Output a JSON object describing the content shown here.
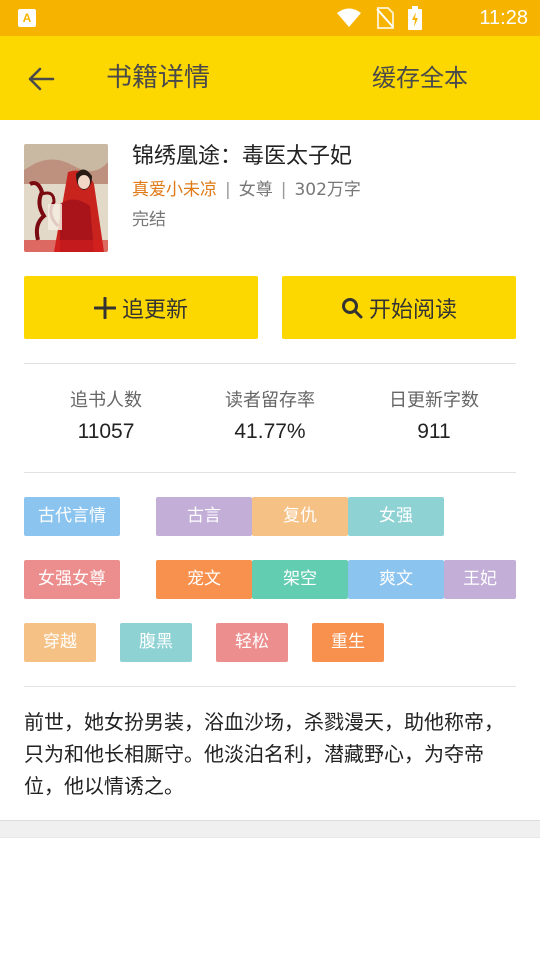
{
  "status_bar": {
    "time": "11:28",
    "icons": [
      "wifi-icon",
      "no-sim-icon",
      "battery-charging-icon"
    ]
  },
  "app_bar": {
    "back_icon": "back-arrow-icon",
    "title": "书籍详情",
    "action_label": "缓存全本"
  },
  "book": {
    "title": "锦绣凰途：毒医太子妃",
    "author": "真爱小未凉",
    "category": "女尊",
    "word_count": "302万字",
    "separator": "|",
    "status": "完结"
  },
  "actions": {
    "follow_label": "追更新",
    "read_label": "开始阅读"
  },
  "stats": [
    {
      "label": "追书人数",
      "value": "11057"
    },
    {
      "label": "读者留存率",
      "value": "41.77%"
    },
    {
      "label": "日更新字数",
      "value": "911"
    }
  ],
  "tags": [
    {
      "label": "古代言情",
      "color": "#8cc4f0"
    },
    {
      "label": "古言",
      "color": "#c3aed8"
    },
    {
      "label": "复仇",
      "color": "#f6c184"
    },
    {
      "label": "女强",
      "color": "#8fd2d4"
    },
    {
      "label": "女强女尊",
      "color": "#ec8e8e"
    },
    {
      "label": "宠文",
      "color": "#f8914e"
    },
    {
      "label": "架空",
      "color": "#62cdb1"
    },
    {
      "label": "爽文",
      "color": "#8cc4f0"
    },
    {
      "label": "王妃",
      "color": "#c3aed8"
    },
    {
      "label": "穿越",
      "color": "#f6c184"
    },
    {
      "label": "腹黑",
      "color": "#8fd2d4"
    },
    {
      "label": "轻松",
      "color": "#ec8e8e"
    },
    {
      "label": "重生",
      "color": "#f8914e"
    }
  ],
  "intro": "前世，她女扮男装，浴血沙场，杀戮漫天，助他称帝，只为和他长相厮守。他淡泊名利，潜藏野心，为夺帝位，他以情诱之。",
  "colors": {
    "status_bar": "#f6b400",
    "app_bar": "#fdd800",
    "button": "#fdd800",
    "author": "#e07a17"
  }
}
